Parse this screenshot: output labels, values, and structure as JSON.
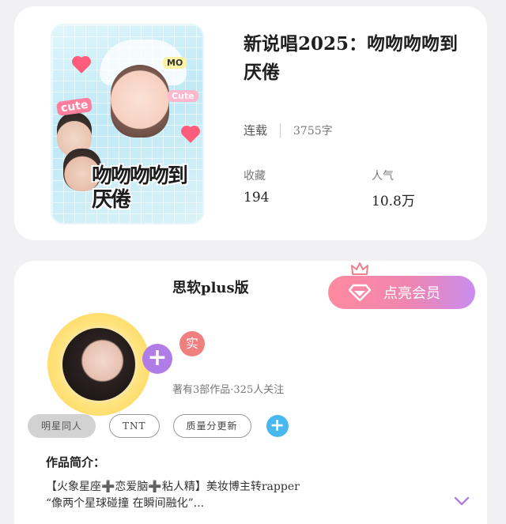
{
  "book": {
    "title": "新说唱2025：吻吻吻吻到厌倦",
    "cover_art_text": "吻吻吻吻到厌倦",
    "cover_stickers": [
      "cute",
      "Cute",
      "MO"
    ],
    "status": "连载",
    "word_count": "3755字",
    "favorites_label": "收藏",
    "favorites_value": "194",
    "popularity_label": "人气",
    "popularity_value": "10.8万"
  },
  "author": {
    "name": "思软plus版",
    "verified_badge": "实",
    "stats": "著有3部作品·325人关注",
    "vip_button": "点亮会员",
    "follow_icon": "plus-icon"
  },
  "tags": {
    "items": [
      "明星同人",
      "TNT",
      "质量分更新"
    ],
    "active_index": 0,
    "add_icon": "plus-icon"
  },
  "intro": {
    "heading": "作品简介：",
    "line1": "【火象星座➕恋爱脑➕粘人精】美妆博主转rapper",
    "line2": "“像两个星球碰撞 在瞬间融化”...",
    "expand_icon": "chevron-down-icon"
  },
  "colors": {
    "background": "#f1f1f3",
    "vip_gradient_start": "#ff8aa0",
    "vip_gradient_end": "#c98cf0",
    "plus_purple": "#b07de6",
    "plus_blue": "#49b8f0",
    "badge_red": "#f07f7f"
  }
}
